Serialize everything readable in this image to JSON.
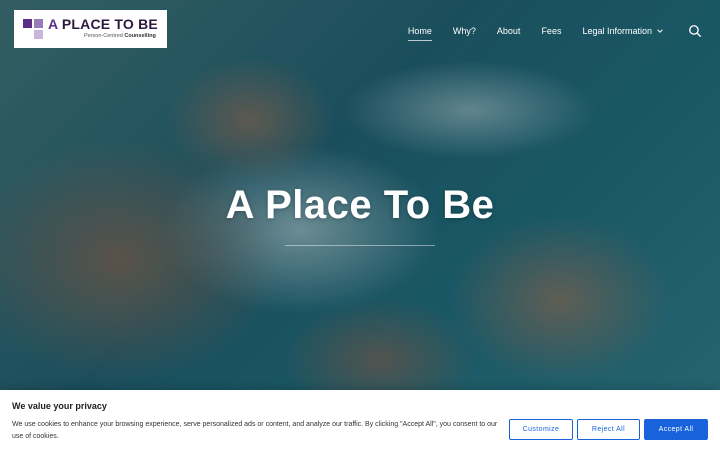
{
  "brand": {
    "prefix": "A",
    "name": "PLACE TO BE",
    "tagline_a": "Person-Centred",
    "tagline_b": "Counselling",
    "colors": {
      "purple": "#5b2d86",
      "lilac": "#9a7bb7",
      "pale": "#c7b6d9"
    }
  },
  "nav": {
    "items": [
      {
        "label": "Home",
        "active": true
      },
      {
        "label": "Why?"
      },
      {
        "label": "About"
      },
      {
        "label": "Fees"
      },
      {
        "label": "Legal Information",
        "has_dropdown": true
      }
    ],
    "search_icon": "search-icon"
  },
  "hero": {
    "title": "A Place To Be"
  },
  "cookie_banner": {
    "title": "We value your privacy",
    "text": "We use cookies to enhance your browsing experience, serve personalized ads or content, and analyze our traffic. By clicking \"Accept All\", you consent to our use of cookies.",
    "customize_label": "Customize",
    "reject_label": "Reject All",
    "accept_label": "Accept All",
    "accent_color": "#1863dc"
  }
}
